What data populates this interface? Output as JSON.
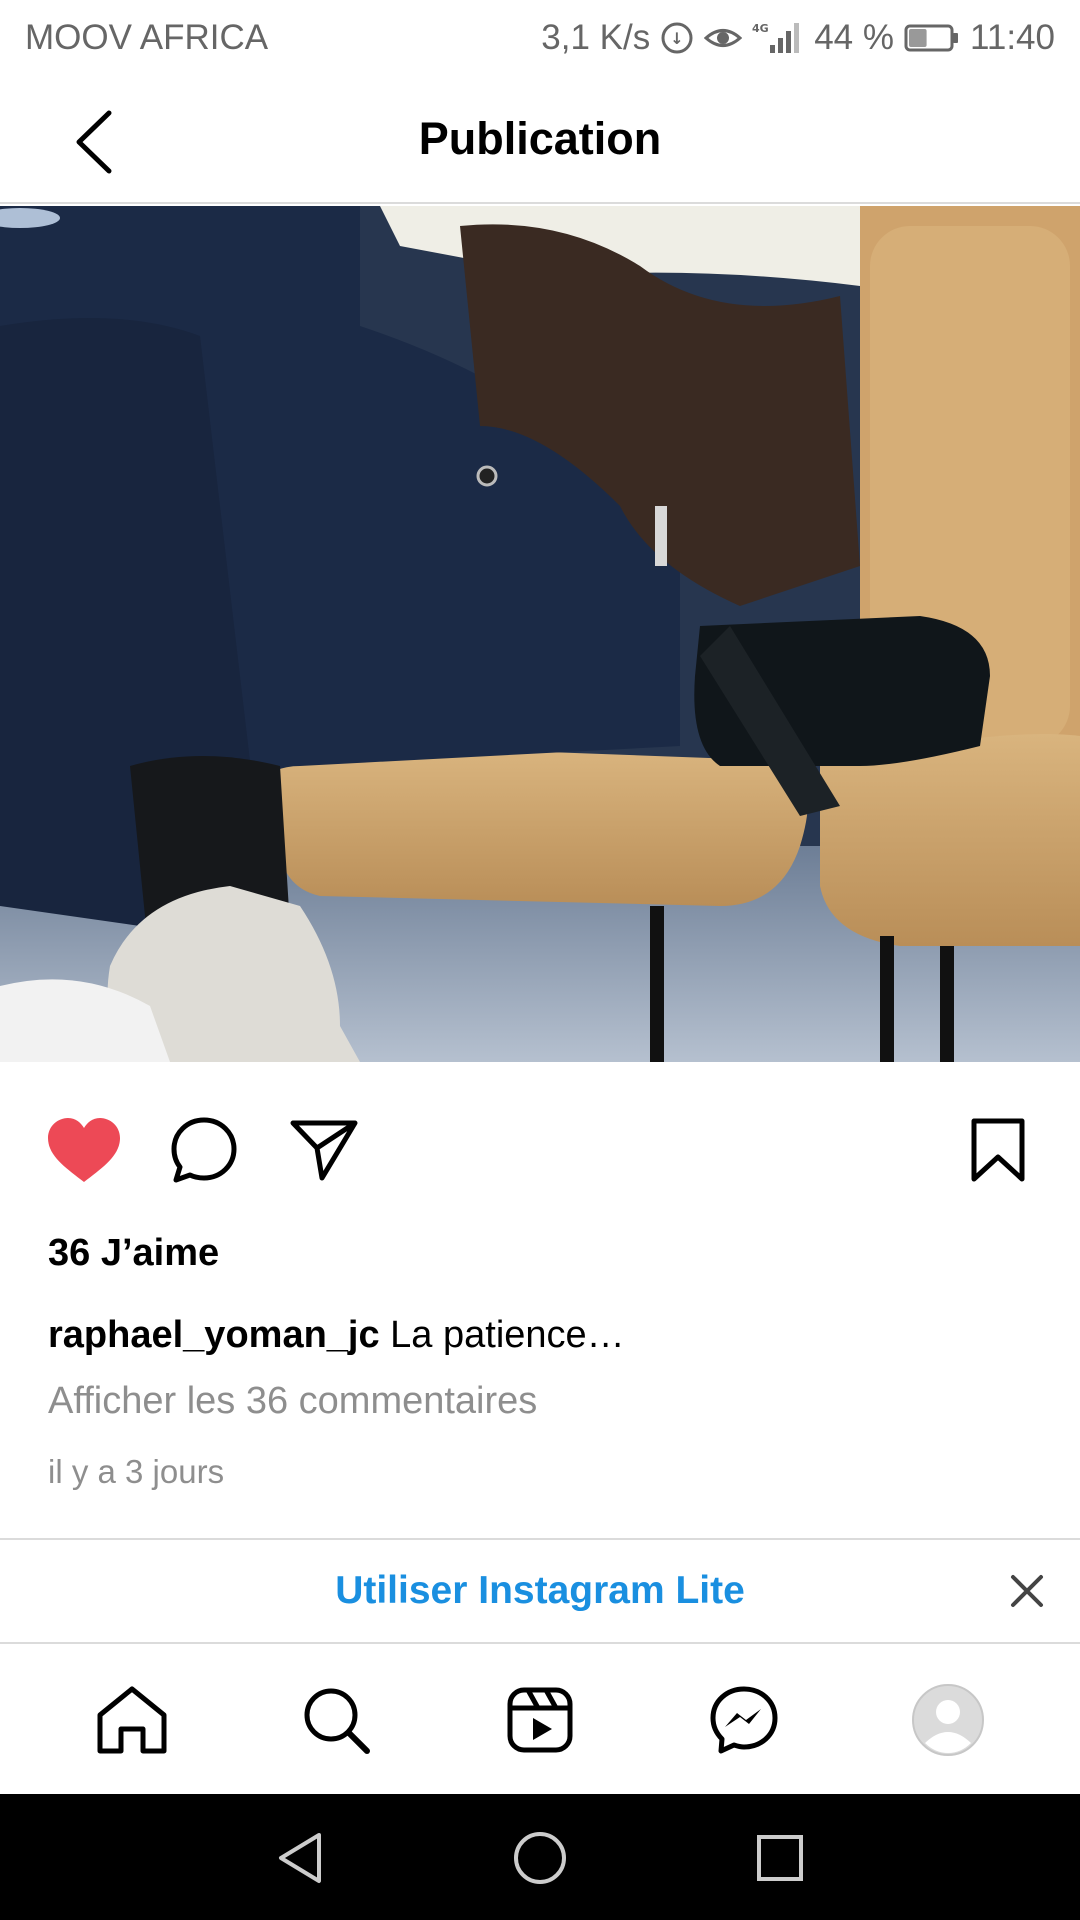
{
  "status_bar": {
    "carrier": "MOOV AFRICA",
    "speed": "3,1 K/s",
    "network": "4G",
    "battery": "44 %",
    "battery_level": 0.44,
    "time": "11:40",
    "icons": [
      "data-saver-icon",
      "eye-comfort-icon",
      "signal-icon",
      "battery-icon"
    ]
  },
  "header": {
    "title": "Publication",
    "back_icon": "chevron-left-icon"
  },
  "post": {
    "photo_icon": "photo",
    "liked": true,
    "likes_text": "36 J’aime",
    "username": "raphael_yoman_jc",
    "caption": "La patience…",
    "comments_link": "Afficher les 36 commentaires",
    "timestamp": "il y a 3 jours"
  },
  "actions": {
    "like_icon": "heart-filled-icon",
    "comment_icon": "comment-icon",
    "share_icon": "send-icon",
    "save_icon": "bookmark-icon",
    "like_color": "#ed4956"
  },
  "lite_banner": {
    "label": "Utiliser Instagram Lite",
    "color": "#1a8fe0",
    "close_icon": "close-icon"
  },
  "bottom_nav": {
    "items": [
      "home-icon",
      "search-icon",
      "reels-icon",
      "messenger-icon",
      "profile-avatar"
    ]
  },
  "system_nav": {
    "items": [
      "back-triangle-icon",
      "home-circle-icon",
      "recents-square-icon"
    ]
  }
}
